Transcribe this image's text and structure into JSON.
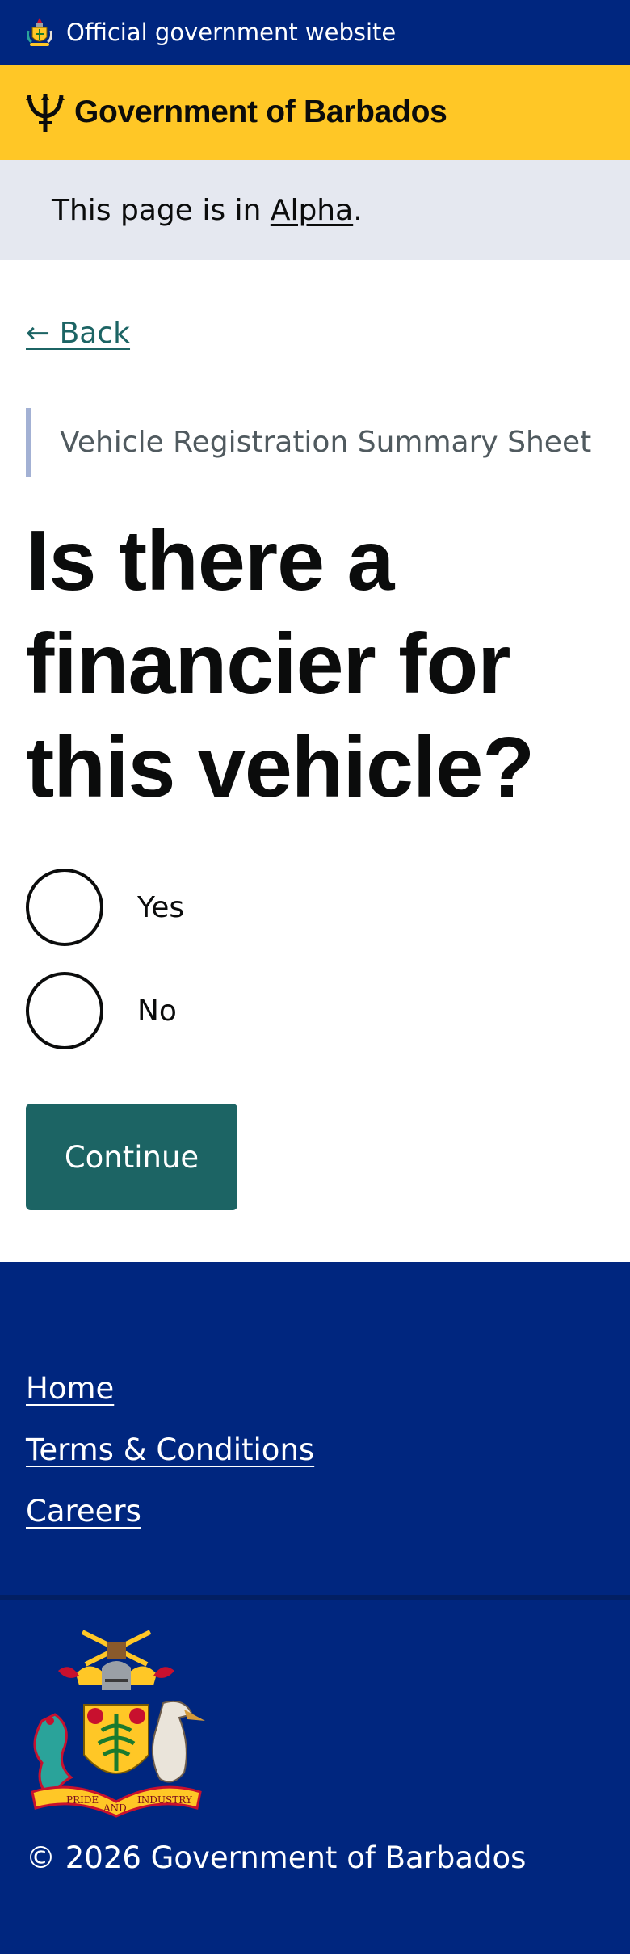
{
  "official_bar": {
    "text": "Official government website",
    "icon": "barbados-crest-icon"
  },
  "header": {
    "title": "Government of Barbados",
    "icon": "trident-icon",
    "brand_color": "#ffc726"
  },
  "phase_banner": {
    "prefix": "This page is in ",
    "phase": "Alpha",
    "suffix": "."
  },
  "back_link": {
    "label": "← Back"
  },
  "caption": "Vehicle Registration Summary Sheet",
  "question": "Is there a financier for this vehicle?",
  "options": [
    {
      "label": "Yes",
      "selected": false
    },
    {
      "label": "No",
      "selected": false
    }
  ],
  "continue_button": {
    "label": "Continue"
  },
  "footer": {
    "links": [
      "Home",
      "Terms & Conditions",
      "Careers"
    ],
    "motto": [
      "PRIDE",
      "AND",
      "INDUSTRY"
    ],
    "copyright": "© 2026 Government of Barbados",
    "background_color": "#00267f"
  },
  "colors": {
    "primary_button": "#1c6464",
    "navy": "#00267f",
    "phase_banner_bg": "#e5e8f0"
  }
}
